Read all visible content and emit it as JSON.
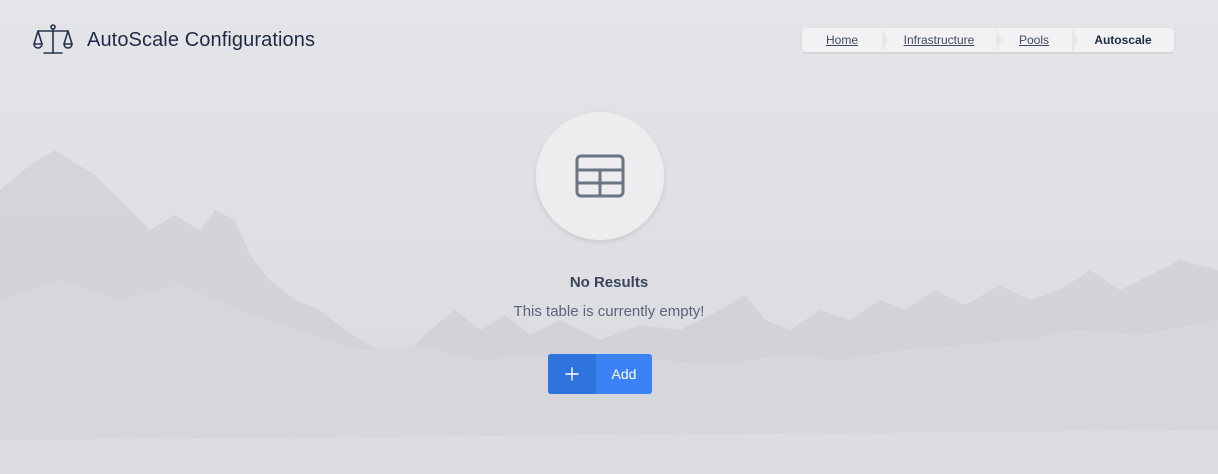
{
  "header": {
    "logo_icon": "balance-scale-icon",
    "title": "AutoScale Configurations"
  },
  "breadcrumb": [
    {
      "label": "Home"
    },
    {
      "label": "Infrastructure"
    },
    {
      "label": "Pools"
    },
    {
      "label": "Autoscale"
    }
  ],
  "empty_state": {
    "icon": "table-icon",
    "title": "No Results",
    "message": "This table is currently empty!",
    "add_icon": "plus-icon",
    "add_label": "Add"
  },
  "colors": {
    "primary": "#3b82f6",
    "primary_dark": "#2f73de",
    "title_text": "#1d2c44"
  }
}
